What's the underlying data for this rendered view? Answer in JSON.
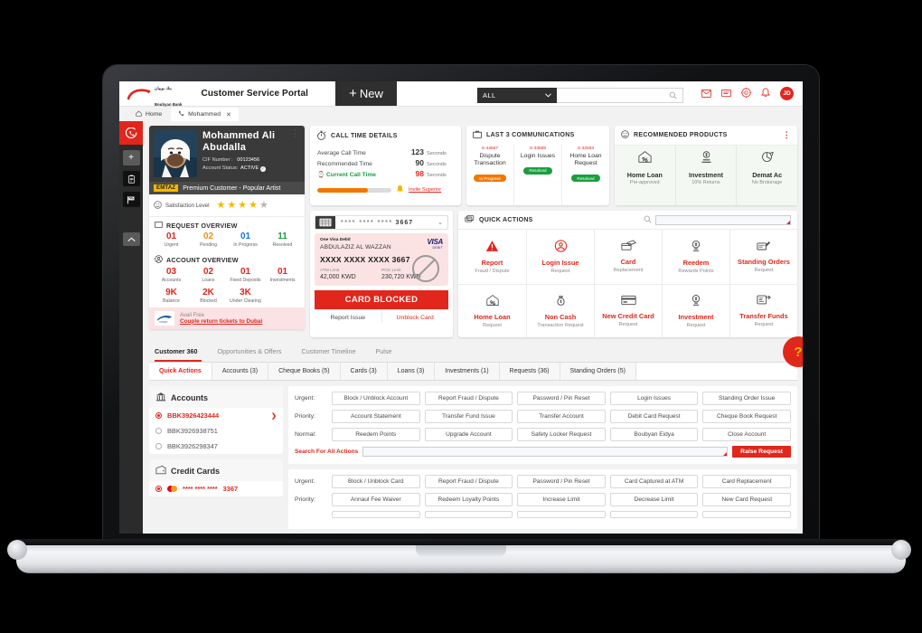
{
  "header": {
    "brand_ar": "بنك بوبيان",
    "brand_en": "Boubyan Bank",
    "title": "Customer Service Portal",
    "new_button": "New",
    "new_plus": "+",
    "search_scope": "ALL",
    "search_placeholder": "",
    "search_value": "",
    "avatar_initials": "JD",
    "icons": [
      "mail-icon",
      "chat-icon",
      "target-icon",
      "bell-icon"
    ]
  },
  "tabs_browser": [
    {
      "label": "Home",
      "icon": "home-icon",
      "active": false,
      "closable": false
    },
    {
      "label": "Mohammed",
      "icon": "phone-icon",
      "active": true,
      "closable": true,
      "close": "✕"
    }
  ],
  "rail": {
    "call_icon": "call-icon",
    "add_label": "+",
    "clipboard_icon": "clipboard-icon",
    "flag_icon": "flag-icon",
    "collapse_icon": "chevron-up-icon"
  },
  "profile": {
    "name": "Mohammed  Ali Abudalla",
    "cif_label": "CIF Number :",
    "cif_value": "00123456",
    "status_label": "Account Status:",
    "status_value": "ACTIVE",
    "menu_icon": "kebab-menu-icon",
    "badge_tag": "EMTAZ",
    "badge_text": "Premium Customer  - Popular Artist",
    "satisfaction_label": "Satisfaction Level",
    "stars_filled": 4,
    "stars_total": 5,
    "request_overview_title": "REQUEST OVERVIEW",
    "request_overview": [
      {
        "n": "01",
        "l": "Urgent",
        "color": "#e1261c"
      },
      {
        "n": "02",
        "l": "Pending",
        "color": "#f28c20"
      },
      {
        "n": "01",
        "l": "In Progress",
        "color": "#1b74e4"
      },
      {
        "n": "11",
        "l": "Resolved",
        "color": "#1a9e3e"
      }
    ],
    "account_overview_title": "ACCOUNT OVERVIEW",
    "account_overview_r1": [
      {
        "n": "03",
        "l": "Accounts"
      },
      {
        "n": "02",
        "l": "Loans"
      },
      {
        "n": "01",
        "l": "Fixed Deposits"
      },
      {
        "n": "01",
        "l": "Investments"
      }
    ],
    "account_overview_r2": [
      {
        "n": "9K",
        "l": "Balance"
      },
      {
        "n": "2K",
        "l": "Blocked"
      },
      {
        "n": "3K",
        "l": "Under Clearing"
      }
    ],
    "promo_line1": "Avail Free",
    "promo_line2": "Couple return tickets to Dubai",
    "promo_logo": "kuwait-airways-logo"
  },
  "call_time": {
    "title": "CALL TIME DETAILS",
    "icon": "stopwatch-icon",
    "rows": [
      {
        "k": "Average Call Time",
        "v": "123",
        "u": "Seconds",
        "current": false
      },
      {
        "k": "Recommended Time",
        "v": "90",
        "u": "Seconds",
        "current": false
      },
      {
        "k": "Current Call Time",
        "v": "98",
        "u": "Seconds",
        "current": true
      }
    ],
    "progress_pct": 68,
    "alert_icon": "bell-alert-icon",
    "invite_link": "Invite Superior"
  },
  "communications": {
    "title": "LAST 3 COMMUNICATIONS",
    "icon": "briefcase-icon",
    "items": [
      {
        "id": "S-43667",
        "title": "Dispute Transaction",
        "status": "In Progress",
        "status_kind": "prog"
      },
      {
        "id": "S-33585",
        "title": "Login Issues",
        "status": "Resolved",
        "status_kind": "res"
      },
      {
        "id": "S-32593",
        "title": "Home Loan Request",
        "status": "Resolved",
        "status_kind": "res"
      }
    ]
  },
  "recommended": {
    "title": "RECOMMENDED PRODUCTS",
    "icon": "smiley-icon",
    "menu_icon": "kebab-menu-icon",
    "items": [
      {
        "t": "Home Loan",
        "s": "Pre-approved",
        "icon": "house-percent-icon"
      },
      {
        "t": "Investment",
        "s": "10% Returns",
        "icon": "investment-icon"
      },
      {
        "t": "Demat Ac",
        "s": "No Brokerage",
        "icon": "demat-icon"
      }
    ]
  },
  "debit_card": {
    "selector_masked": "**** **** ****",
    "selector_last4": "3667",
    "chip_icon": "card-chip-icon",
    "chevron": "⌄",
    "brand_label": "One Visa Debit",
    "holder": "ABDULAZIZ AL WAZZAN",
    "pan": "XXXX XXXX XXXX 3667",
    "atm_limit_label": "ATM Limit",
    "atm_limit_value": "42,000 KWD",
    "pos_limit_label": "POS Limit",
    "pos_limit_value": "230,720 KWD",
    "network": "VISA",
    "network_sub": "DEBIT",
    "blocked_banner": "CARD BLOCKED",
    "action_report": "Report Issue",
    "action_unblock": "Unblock Card"
  },
  "quick_actions": {
    "title": "QUICK ACTIONS",
    "icon": "quick-actions-icon",
    "search_placeholder": "",
    "search_value": "",
    "items": [
      {
        "t": "Report",
        "s": "Fraud / Dispute",
        "icon": "warning-icon"
      },
      {
        "t": "Login Issue",
        "s": "Request",
        "icon": "user-circle-icon"
      },
      {
        "t": "Card",
        "s": "Replacement",
        "icon": "card-swap-icon"
      },
      {
        "t": "Reedem",
        "s": "Rewards Points",
        "icon": "medal-icon"
      },
      {
        "t": "Standing Orders",
        "s": "Request",
        "icon": "form-edit-icon"
      },
      {
        "t": "Home Loan",
        "s": "Request",
        "icon": "house-percent-icon"
      },
      {
        "t": "Non Cash",
        "s": "Transaction Request",
        "icon": "money-bag-icon"
      },
      {
        "t": "New Credit Card",
        "s": "Request",
        "icon": "credit-card-icon"
      },
      {
        "t": "Investment",
        "s": "Request",
        "icon": "investment-icon"
      },
      {
        "t": "Transfer Funds",
        "s": "Request",
        "icon": "transfer-icon"
      }
    ]
  },
  "main_tabs": [
    {
      "label": "Customer 360",
      "active": true
    },
    {
      "label": "Opportunities & Offers",
      "active": false
    },
    {
      "label": "Customer Timeline",
      "active": false
    },
    {
      "label": "Pulse",
      "active": false
    }
  ],
  "sub_tabs": [
    {
      "label": "Quick Actions",
      "active": true
    },
    {
      "label": "Accounts (3)",
      "active": false
    },
    {
      "label": "Cheque Books (5)",
      "active": false
    },
    {
      "label": "Cards (3)",
      "active": false
    },
    {
      "label": "Loans (3)",
      "active": false
    },
    {
      "label": "Investments (1)",
      "active": false
    },
    {
      "label": "Requests (36)",
      "active": false
    },
    {
      "label": "Standing Orders (5)",
      "active": false
    }
  ],
  "accounts_panel": {
    "title": "Accounts",
    "icon": "bank-icon",
    "items": [
      {
        "label": "BBK3926423444",
        "selected": true
      },
      {
        "label": "BBK3926938751",
        "selected": false
      },
      {
        "label": "BBK3926298347",
        "selected": false
      }
    ]
  },
  "cards_panel": {
    "title": "Credit Cards",
    "icon": "wallet-icon",
    "items": [
      {
        "masked": "**** **** ****",
        "last4": "3367",
        "selected": true,
        "network": "mastercard-logo"
      }
    ]
  },
  "accounts_actions": {
    "rows": [
      {
        "k": "Urgent:",
        "buttons": [
          "Block / Unblock Account",
          "Report Fraud / Dispute",
          "Password / Pin Reset",
          "Login Issues",
          "Standing Order Issue"
        ]
      },
      {
        "k": "Priority:",
        "buttons": [
          "Account Statement",
          "Transfer Fund Issue",
          "Transfer Account",
          "Debit Card Request",
          "Cheque Book Request"
        ]
      },
      {
        "k": "Normal:",
        "buttons": [
          "Reedem Points",
          "Upgrade Account",
          "Safety Locker Request",
          "Boubyan Eidya",
          "Close Account"
        ]
      }
    ],
    "search_label": "Search For All Actions",
    "search_value": "",
    "raise_button": "Raise Request"
  },
  "cards_actions": {
    "rows": [
      {
        "k": "Urgent:",
        "buttons": [
          "Block / Unblock Card",
          "Report Fraud / Dispute",
          "Password / Pin Reset",
          "Card Captured at ATM",
          "Card Replacement"
        ]
      },
      {
        "k": "Priority:",
        "buttons": [
          "Annaul Fee Waiver",
          "Redeem Loyalty Points",
          "Increase Limit",
          "Decrease Limit",
          "New Card Request"
        ]
      }
    ]
  },
  "help_fab": {
    "label": "?",
    "name": "help-button"
  },
  "colors": {
    "brand_red": "#e1261c",
    "gold": "#f5b800",
    "green": "#1a9e3e",
    "orange": "#f07800",
    "blue": "#1b74e4",
    "dark": "#2b2b2b"
  }
}
